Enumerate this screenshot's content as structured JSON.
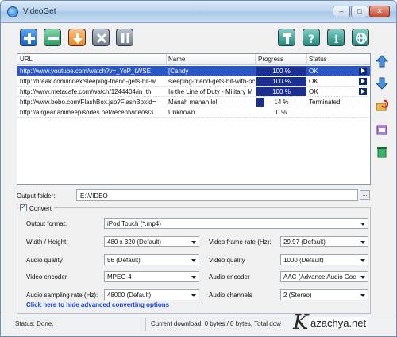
{
  "window": {
    "title": "VideoGet"
  },
  "toolbar": {
    "buttons": [
      "add",
      "remove",
      "download",
      "stop",
      "pause",
      "settings",
      "help",
      "info",
      "web"
    ]
  },
  "downloads": {
    "columns": [
      "URL",
      "Name",
      "Progress",
      "Status"
    ],
    "rows": [
      {
        "url": "http://www.youtube.com/watch?v=_YoP_tWSE",
        "name": "[Candy",
        "progress": "100 %",
        "progress_value": 100,
        "status": "OK"
      },
      {
        "url": "http://break.com/index/sleeping-friend-gets-hit-w",
        "name": "sleeping-friend-gets-hit-with-pc",
        "progress": "100 %",
        "progress_value": 100,
        "status": "OK"
      },
      {
        "url": "http://www.metacafe.com/watch/1244404/in_th",
        "name": "In the Line of Duty - Military M",
        "progress": "100 %",
        "progress_value": 100,
        "status": "OK"
      },
      {
        "url": "http://www.bebo.com/FlashBox.jsp?FlashBoxId=",
        "name": "Manah manah lol",
        "progress": "14 %",
        "progress_value": 14,
        "status": "Terminated"
      },
      {
        "url": "http://airgear.animeepisodes.net/recentvideos/3.",
        "name": "Unknown",
        "progress": "0 %",
        "progress_value": 0,
        "status": ""
      }
    ]
  },
  "output": {
    "label": "Output folder:",
    "value": "E:\\VIDEO",
    "browse": "..."
  },
  "convert": {
    "label": "Convert",
    "checked": true,
    "format_label": "Output format:",
    "format_value": "iPod Touch (*.mp4)",
    "width_height_label": "Width / Height:",
    "width_height_value": "480 x 320 (Default)",
    "frame_rate_label": "Video frame rate (Hz):",
    "frame_rate_value": "29.97 (Default)",
    "audio_quality_label": "Audio quality",
    "audio_quality_value": "56 (Default)",
    "video_quality_label": "Video quality",
    "video_quality_value": "1000 (Default)",
    "video_encoder_label": "Video encoder",
    "video_encoder_value": "MPEG-4",
    "audio_encoder_label": "Audio encoder",
    "audio_encoder_value": "AAC (Advance Audio Coc",
    "sampling_label": "Audio sampling rate (Hz):",
    "sampling_value": "48000 (Default)",
    "channels_label": "Audio channels",
    "channels_value": "2 (Stereo)",
    "hide_link": "Click here to hide advanced converting options"
  },
  "status": {
    "left": "Status: Done.",
    "right": "Current download: 0 bytes / 0 bytes,  Total dow"
  },
  "watermark": {
    "k": "K",
    "rest": "azachya.net"
  },
  "colors": {
    "progress_fill": "#1a2f8f",
    "selection": "#2a56c6",
    "link": "#1a3fbf"
  }
}
